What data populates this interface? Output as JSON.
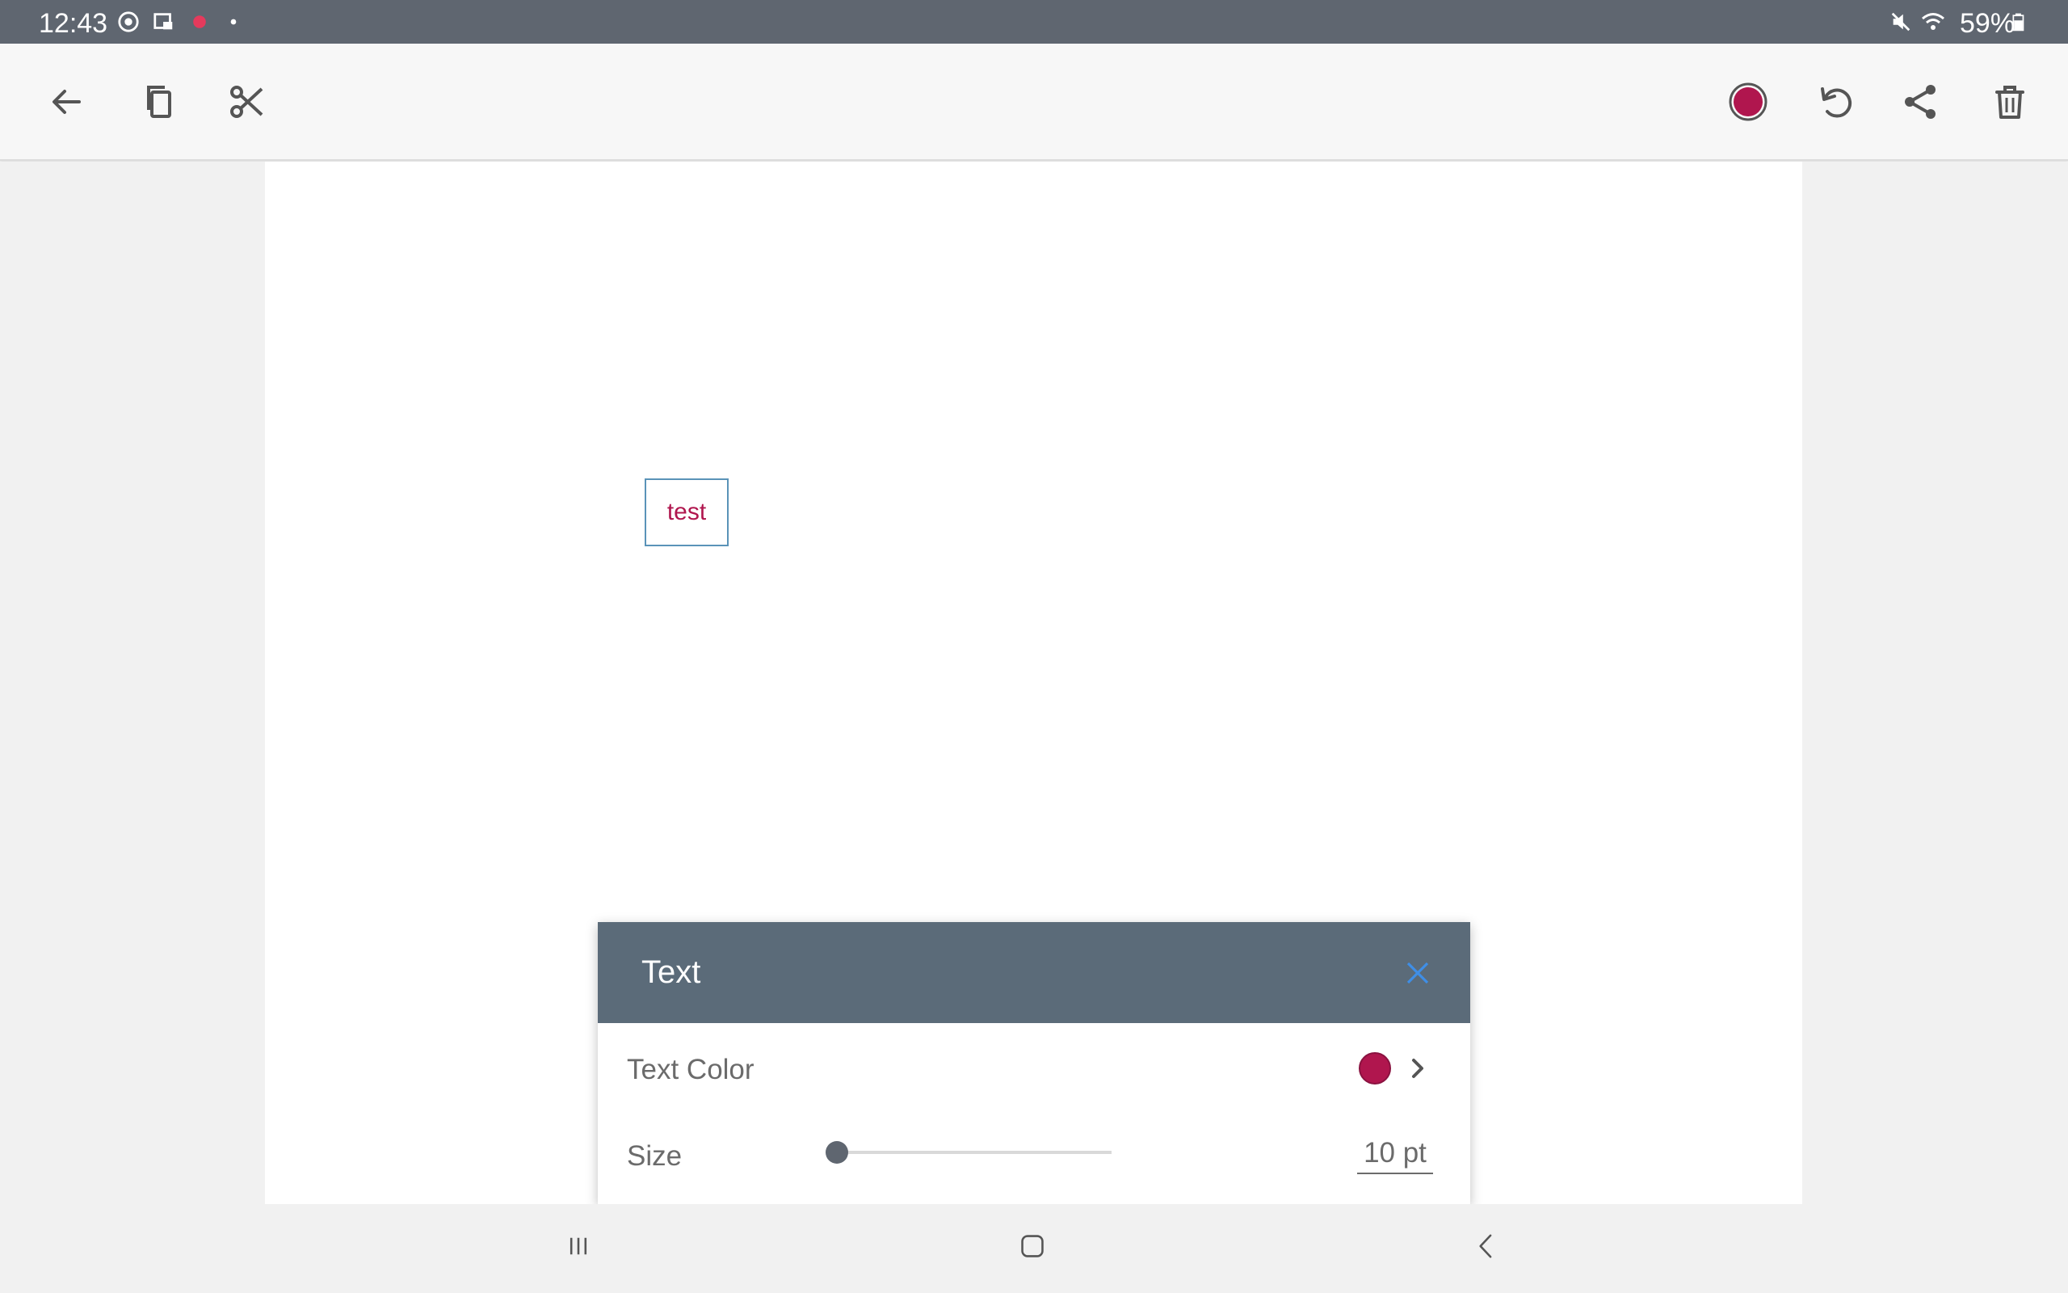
{
  "status_bar": {
    "time": "12:43",
    "battery_percent": "59%",
    "icons": [
      "chrome-icon",
      "gallery-icon",
      "recording-icon",
      "dot-icon",
      "mute-icon",
      "wifi-icon",
      "battery-icon"
    ]
  },
  "toolbar": {
    "left_actions": [
      "back-arrow-icon",
      "copy-icon",
      "cut-icon"
    ],
    "right_actions": [
      "color-icon",
      "undo-icon",
      "share-icon",
      "delete-icon"
    ],
    "accent_color": "#b0164e"
  },
  "canvas": {
    "text_element": "test"
  },
  "text_panel": {
    "title": "Text",
    "text_color_label": "Text Color",
    "text_color_value": "#b0164e",
    "size_label": "Size",
    "size_value": "10 pt",
    "size_slider_fraction": 0.0
  },
  "nav_bar": {
    "buttons": [
      "recents-icon",
      "home-icon",
      "back-icon"
    ]
  }
}
